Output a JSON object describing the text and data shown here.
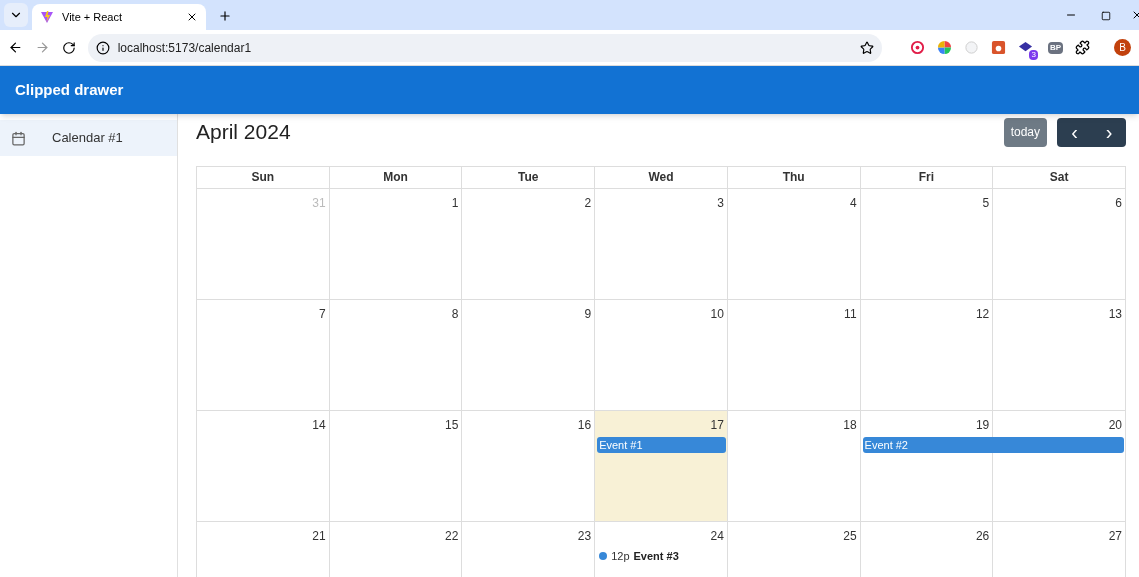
{
  "browser": {
    "tab": {
      "title": "Vite + React"
    },
    "url": "localhost:5173/calendar1",
    "extension_badge": "3",
    "extension_text": "BP",
    "profile": "B"
  },
  "app_bar": {
    "title": "Clipped drawer"
  },
  "sidebar": {
    "items": [
      {
        "label": "Calendar #1",
        "selected": true
      }
    ]
  },
  "calendar": {
    "title": "April 2024",
    "today_button": "today",
    "prev": "‹",
    "next": "›",
    "weekdays": [
      "Sun",
      "Mon",
      "Tue",
      "Wed",
      "Thu",
      "Fri",
      "Sat"
    ],
    "weeks": [
      {
        "days": [
          {
            "number": "31",
            "other_month": true,
            "today": false
          },
          {
            "number": "1",
            "other_month": false,
            "today": false
          },
          {
            "number": "2",
            "other_month": false,
            "today": false
          },
          {
            "number": "3",
            "other_month": false,
            "today": false
          },
          {
            "number": "4",
            "other_month": false,
            "today": false
          },
          {
            "number": "5",
            "other_month": false,
            "today": false
          },
          {
            "number": "6",
            "other_month": false,
            "today": false
          }
        ]
      },
      {
        "days": [
          {
            "number": "7",
            "other_month": false,
            "today": false
          },
          {
            "number": "8",
            "other_month": false,
            "today": false
          },
          {
            "number": "9",
            "other_month": false,
            "today": false
          },
          {
            "number": "10",
            "other_month": false,
            "today": false
          },
          {
            "number": "11",
            "other_month": false,
            "today": false
          },
          {
            "number": "12",
            "other_month": false,
            "today": false
          },
          {
            "number": "13",
            "other_month": false,
            "today": false
          }
        ]
      },
      {
        "days": [
          {
            "number": "14",
            "other_month": false,
            "today": false
          },
          {
            "number": "15",
            "other_month": false,
            "today": false
          },
          {
            "number": "16",
            "other_month": false,
            "today": false
          },
          {
            "number": "17",
            "other_month": false,
            "today": true,
            "events": [
              {
                "kind": "block",
                "title": "Event #1",
                "continues": false,
                "color": "#3788d8"
              }
            ]
          },
          {
            "number": "18",
            "other_month": false,
            "today": false
          },
          {
            "number": "19",
            "other_month": false,
            "today": false,
            "events": [
              {
                "kind": "block",
                "title": "Event #2",
                "continues": true,
                "color": "#3788d8"
              }
            ]
          },
          {
            "number": "20",
            "other_month": false,
            "today": false
          }
        ]
      },
      {
        "days": [
          {
            "number": "21",
            "other_month": false,
            "today": false
          },
          {
            "number": "22",
            "other_month": false,
            "today": false
          },
          {
            "number": "23",
            "other_month": false,
            "today": false
          },
          {
            "number": "24",
            "other_month": false,
            "today": false,
            "events": [
              {
                "kind": "dot",
                "time": "12p",
                "title": "Event #3",
                "color": "#3788d8"
              }
            ]
          },
          {
            "number": "25",
            "other_month": false,
            "today": false
          },
          {
            "number": "26",
            "other_month": false,
            "today": false
          },
          {
            "number": "27",
            "other_month": false,
            "today": false
          }
        ]
      }
    ]
  }
}
